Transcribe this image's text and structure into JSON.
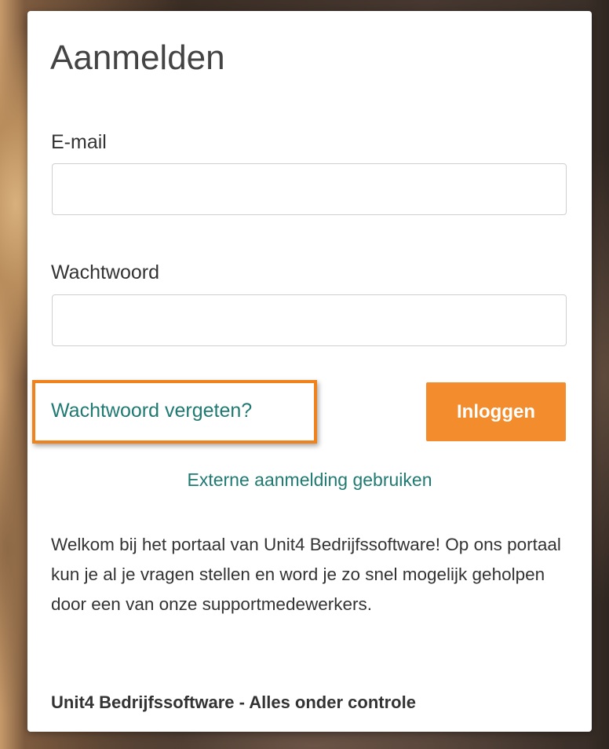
{
  "login": {
    "title": "Aanmelden",
    "email_label": "E-mail",
    "email_value": "",
    "password_label": "Wachtwoord",
    "password_value": "",
    "forgot_password_link": "Wachtwoord vergeten?",
    "login_button": "Inloggen",
    "external_login_link": "Externe aanmelding gebruiken",
    "welcome_text": "Welkom bij het portaal van Unit4 Bedrijfssoftware! Op ons portaal kun je al je vragen stellen en word je zo snel mogelijk geholpen door een van onze supportmedewerkers.",
    "tagline": "Unit4 Bedrijfssoftware - Alles onder controle"
  },
  "colors": {
    "accent": "#f28c2c",
    "link": "#1f7a72",
    "highlight": "#f0821e"
  }
}
